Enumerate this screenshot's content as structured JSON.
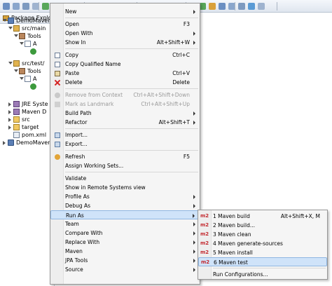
{
  "explorer": {
    "title": "Package Explorer",
    "tree": [
      {
        "label": "DemoMaven",
        "icon": "project-icon",
        "twist": "open"
      },
      {
        "label": "src/main",
        "icon": "source-folder-icon",
        "twist": "open"
      },
      {
        "label": "Tools",
        "icon": "package-icon",
        "twist": "open"
      },
      {
        "label": "A",
        "icon": "java-file-icon",
        "twist": "open"
      },
      {
        "label": "",
        "icon": "class-icon",
        "twist": "none"
      },
      {
        "label": "src/test/",
        "icon": "source-folder-icon",
        "twist": "open"
      },
      {
        "label": "Tools",
        "icon": "package-icon",
        "twist": "open"
      },
      {
        "label": "A",
        "icon": "java-file-icon",
        "twist": "open"
      },
      {
        "label": "",
        "icon": "class-icon",
        "twist": "none"
      },
      {
        "label": "JRE Syste",
        "icon": "library-icon",
        "twist": "closed"
      },
      {
        "label": "Maven D",
        "icon": "library-icon",
        "twist": "closed"
      },
      {
        "label": "src",
        "icon": "folder-icon",
        "twist": "closed"
      },
      {
        "label": "target",
        "icon": "folder-icon",
        "twist": "closed"
      },
      {
        "label": "pom.xml",
        "icon": "xml-file-icon",
        "twist": "none"
      },
      {
        "label": "DemoMaven",
        "icon": "project-icon",
        "twist": "closed"
      }
    ]
  },
  "context_menu": {
    "items": [
      {
        "label": "New",
        "shortcut": "",
        "submenu": true,
        "icon": "",
        "disabled": false
      },
      {
        "sep": true
      },
      {
        "label": "Open",
        "shortcut": "F3",
        "submenu": false,
        "icon": "",
        "disabled": false
      },
      {
        "label": "Open With",
        "shortcut": "",
        "submenu": true,
        "icon": "",
        "disabled": false
      },
      {
        "label": "Show In",
        "shortcut": "Alt+Shift+W",
        "submenu": true,
        "icon": "",
        "disabled": false
      },
      {
        "sep": true
      },
      {
        "label": "Copy",
        "shortcut": "Ctrl+C",
        "submenu": false,
        "icon": "copy-icon",
        "disabled": false
      },
      {
        "label": "Copy Qualified Name",
        "shortcut": "",
        "submenu": false,
        "icon": "copy-icon",
        "disabled": false
      },
      {
        "label": "Paste",
        "shortcut": "Ctrl+V",
        "submenu": false,
        "icon": "paste-icon",
        "disabled": false
      },
      {
        "label": "Delete",
        "shortcut": "Delete",
        "submenu": false,
        "icon": "delete-icon",
        "disabled": false
      },
      {
        "sep": true
      },
      {
        "label": "Remove from Context",
        "shortcut": "Ctrl+Alt+Shift+Down",
        "submenu": false,
        "icon": "remove-context-icon",
        "disabled": true
      },
      {
        "label": "Mark as Landmark",
        "shortcut": "Ctrl+Alt+Shift+Up",
        "submenu": false,
        "icon": "landmark-icon",
        "disabled": true
      },
      {
        "label": "Build Path",
        "shortcut": "",
        "submenu": true,
        "icon": "",
        "disabled": false
      },
      {
        "label": "Refactor",
        "shortcut": "Alt+Shift+T",
        "submenu": true,
        "icon": "",
        "disabled": false
      },
      {
        "sep": true
      },
      {
        "label": "Import...",
        "shortcut": "",
        "submenu": false,
        "icon": "import-icon",
        "disabled": false
      },
      {
        "label": "Export...",
        "shortcut": "",
        "submenu": false,
        "icon": "export-icon",
        "disabled": false
      },
      {
        "sep": true
      },
      {
        "label": "Refresh",
        "shortcut": "F5",
        "submenu": false,
        "icon": "refresh-icon",
        "disabled": false
      },
      {
        "label": "Assign Working Sets...",
        "shortcut": "",
        "submenu": false,
        "icon": "",
        "disabled": false
      },
      {
        "sep": true
      },
      {
        "label": "Validate",
        "shortcut": "",
        "submenu": false,
        "icon": "",
        "disabled": false
      },
      {
        "label": "Show in Remote Systems view",
        "shortcut": "",
        "submenu": false,
        "icon": "",
        "disabled": false
      },
      {
        "label": "Profile As",
        "shortcut": "",
        "submenu": true,
        "icon": "",
        "disabled": false
      },
      {
        "label": "Debug As",
        "shortcut": "",
        "submenu": true,
        "icon": "",
        "disabled": false
      },
      {
        "label": "Run As",
        "shortcut": "",
        "submenu": true,
        "icon": "",
        "disabled": false,
        "highlighted": true
      },
      {
        "label": "Team",
        "shortcut": "",
        "submenu": true,
        "icon": "",
        "disabled": false
      },
      {
        "label": "Compare With",
        "shortcut": "",
        "submenu": true,
        "icon": "",
        "disabled": false
      },
      {
        "label": "Replace With",
        "shortcut": "",
        "submenu": true,
        "icon": "",
        "disabled": false
      },
      {
        "label": "Maven",
        "shortcut": "",
        "submenu": true,
        "icon": "",
        "disabled": false
      },
      {
        "label": "JPA Tools",
        "shortcut": "",
        "submenu": true,
        "icon": "",
        "disabled": false
      },
      {
        "label": "Source",
        "shortcut": "",
        "submenu": true,
        "icon": "",
        "disabled": false
      }
    ]
  },
  "run_as_submenu": {
    "items": [
      {
        "badge": "m2",
        "label": "1 Maven build",
        "shortcut": "Alt+Shift+X, M"
      },
      {
        "badge": "m2",
        "label": "2 Maven build...",
        "shortcut": ""
      },
      {
        "badge": "m2",
        "label": "3 Maven clean",
        "shortcut": ""
      },
      {
        "badge": "m2",
        "label": "4 Maven generate-sources",
        "shortcut": ""
      },
      {
        "badge": "m2",
        "label": "5 Maven install",
        "shortcut": ""
      },
      {
        "badge": "m2",
        "label": "6 Maven test",
        "shortcut": "",
        "highlighted": true
      },
      {
        "sep": true
      },
      {
        "badge": "",
        "label": "Run Configurations...",
        "shortcut": ""
      }
    ]
  }
}
